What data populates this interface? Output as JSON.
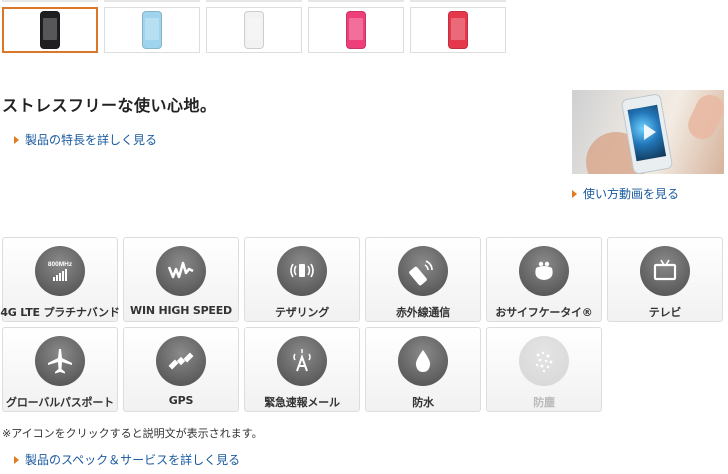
{
  "colors": {
    "accent_orange": "#d9772b",
    "link_blue": "#1a5aa0",
    "icon_gray": "#5e5e5e"
  },
  "thumbnails": [
    {
      "color": "#1f1f22",
      "selected": true
    },
    {
      "color": "#9fd4ee",
      "selected": false
    },
    {
      "color": "#f2f2f2",
      "selected": false
    },
    {
      "color": "#ee3f7a",
      "selected": false
    },
    {
      "color": "#e5384d",
      "selected": false
    }
  ],
  "headline": "ストレスフリーな使い心地。",
  "links": {
    "features": "製品の特長を詳しく見る",
    "video": "使い方動画を見る",
    "specs": "製品のスペック＆サービスを詳しく見る"
  },
  "features": [
    {
      "label": "4G LTE プラチナバンド",
      "icon": "lte-800mhz-icon",
      "badge": "800MHz",
      "enabled": true
    },
    {
      "label": "WIN HIGH SPEED",
      "icon": "high-speed-wave-icon",
      "enabled": true
    },
    {
      "label": "テザリング",
      "icon": "tethering-icon",
      "enabled": true
    },
    {
      "label": "赤外線通信",
      "icon": "infrared-icon",
      "enabled": true
    },
    {
      "label": "おサイフケータイ®",
      "icon": "wallet-icon",
      "enabled": true
    },
    {
      "label": "テレビ",
      "icon": "tv-icon",
      "enabled": true
    },
    {
      "label": "グローバルパスポート",
      "icon": "airplane-icon",
      "enabled": true
    },
    {
      "label": "GPS",
      "icon": "satellite-icon",
      "enabled": true
    },
    {
      "label": "緊急速報メール",
      "icon": "emergency-alert-icon",
      "enabled": true
    },
    {
      "label": "防水",
      "icon": "water-drop-icon",
      "enabled": true
    },
    {
      "label": "防塵",
      "icon": "dust-icon",
      "enabled": false
    }
  ],
  "note": "※アイコンをクリックすると説明文が表示されます。"
}
